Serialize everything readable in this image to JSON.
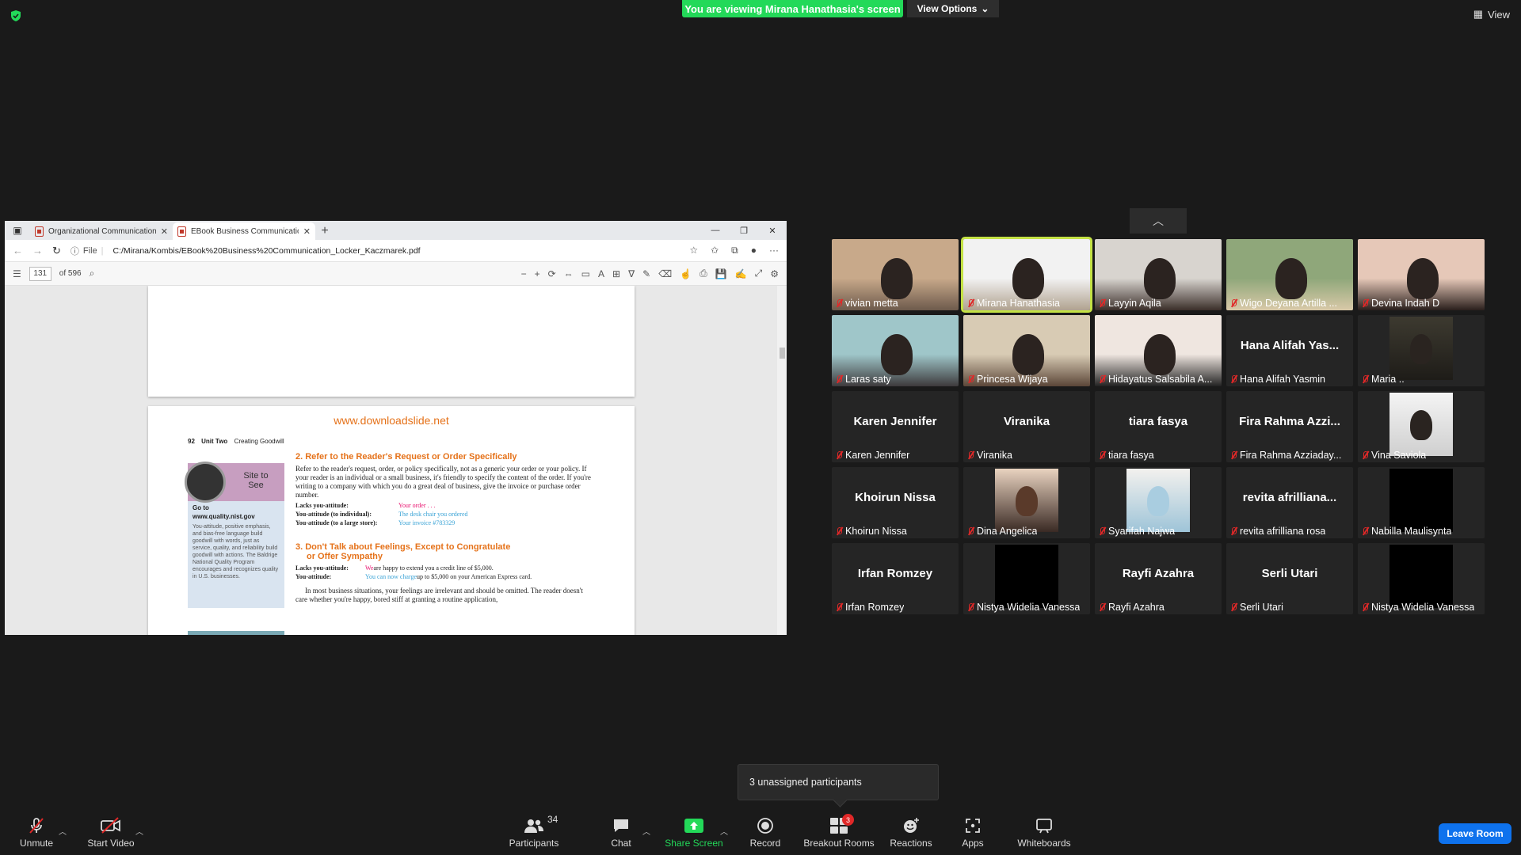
{
  "top": {
    "viewing_banner": "You are viewing Mirana Hanathasia's screen",
    "view_options": "View Options",
    "view_label": "View",
    "colors": {
      "banner_green": "#23d959",
      "leave_blue": "#0e72ed",
      "active_speaker": "#c4e245",
      "muted_red": "#e02828"
    }
  },
  "browser": {
    "tabs": [
      {
        "title": "Organizational Communication ..."
      },
      {
        "title": "EBook Business Communication..."
      }
    ],
    "address_prefix": "File",
    "url": "C:/Mirana/Kombis/EBook%20Business%20Communication_Locker_Kaczmarek.pdf",
    "page_current": "131",
    "page_total": "of 596"
  },
  "pdf": {
    "download_link": "www.downloadslide.net",
    "page_number": "92",
    "unit_label": "Unit Two",
    "unit_title": "Creating Goodwill",
    "sidebox": {
      "title": "Site to See",
      "goto": "Go to",
      "url": "www.quality.nist.gov",
      "body": "You-attitude, positive emphasis, and bias-free language build goodwill with words, just as service, quality, and reliability build goodwill with actions. The Baldrige National Quality Program encourages and recognizes quality in U.S. businesses."
    },
    "section2_title": "2. Refer to the Reader's Request or Order Specifically",
    "section2_body": "Refer to the reader's request, order, or policy specifically, not as a generic your order or your policy. If your reader is an individual or a small business, it's friendly to specify the content of the order. If you're writing to a company with which you do a great deal of business, give the invoice or purchase order number.",
    "section2_examples": [
      {
        "label": "Lacks you-attitude:",
        "text": "Your order . . ."
      },
      {
        "label": "You-attitude (to individual):",
        "text": "The desk chair you ordered"
      },
      {
        "label": "You-attitude (to a large store):",
        "text": "Your invoice #783329"
      }
    ],
    "section3_title_1": "3. Don't Talk about Feelings, Except to Congratulate",
    "section3_title_2": "or Offer Sympathy",
    "section3_examples": [
      {
        "label": "Lacks you-attitude:",
        "lead": "We",
        "text": " are happy to extend you a credit line of $5,000."
      },
      {
        "label": "You-attitude:",
        "lead": "You can now charge",
        "text": " up to $5,000 on your American Express card."
      }
    ],
    "section3_body": "In most business situations, your feelings are irrelevant and should be omitted. The reader doesn't care whether you're happy, bored stiff at granting a routine application,"
  },
  "participants": [
    {
      "name": "vivian metta",
      "type": "video"
    },
    {
      "name": "Mirana Hanathasia",
      "type": "video",
      "active": true
    },
    {
      "name": "Layyin Aqila",
      "type": "video"
    },
    {
      "name": "Wigo Deyana Artilla ...",
      "type": "video"
    },
    {
      "name": "Devina Indah D",
      "type": "video"
    },
    {
      "name": "Laras saty",
      "type": "video"
    },
    {
      "name": "Princesa Wijaya",
      "type": "video"
    },
    {
      "name": "Hidayatus Salsabila A...",
      "type": "video"
    },
    {
      "name": "Hana Alifah Yasmin",
      "type": "name",
      "big": "Hana Alifah Yas..."
    },
    {
      "name": "Maria ..",
      "type": "video-small"
    },
    {
      "name": "Karen Jennifer",
      "type": "name",
      "big": "Karen Jennifer"
    },
    {
      "name": "Viranika",
      "type": "name",
      "big": "Viranika"
    },
    {
      "name": "tiara fasya",
      "type": "name",
      "big": "tiara fasya"
    },
    {
      "name": "Fira Rahma Azziaday...",
      "type": "name",
      "big": "Fira Rahma Azzi..."
    },
    {
      "name": "Vina Saviola",
      "type": "video-small"
    },
    {
      "name": "Khoirun Nissa",
      "type": "name",
      "big": "Khoirun Nissa"
    },
    {
      "name": "Dina Angelica",
      "type": "video-small"
    },
    {
      "name": "Syarifah Najwa",
      "type": "video-small"
    },
    {
      "name": "revita afrilliana rosa",
      "type": "name",
      "big": "revita afrilliana..."
    },
    {
      "name": "Nabilla Maulisynta",
      "type": "black"
    },
    {
      "name": "Irfan Romzey",
      "type": "name",
      "big": "Irfan Romzey"
    },
    {
      "name": "Nistya Widelia Vanessa",
      "type": "black"
    },
    {
      "name": "Rayfi Azahra",
      "type": "name",
      "big": "Rayfi Azahra"
    },
    {
      "name": "Serli Utari",
      "type": "name",
      "big": "Serli Utari"
    },
    {
      "name": "Nistya Widelia Vanessa",
      "type": "black"
    }
  ],
  "popup": {
    "text": "3 unassigned participants"
  },
  "toolbar": {
    "unmute": "Unmute",
    "start_video": "Start Video",
    "participants": "Participants",
    "participants_count": "34",
    "chat": "Chat",
    "share_screen": "Share Screen",
    "record": "Record",
    "breakout_rooms": "Breakout Rooms",
    "breakout_badge": "3",
    "reactions": "Reactions",
    "apps": "Apps",
    "whiteboards": "Whiteboards",
    "leave_room": "Leave Room"
  }
}
